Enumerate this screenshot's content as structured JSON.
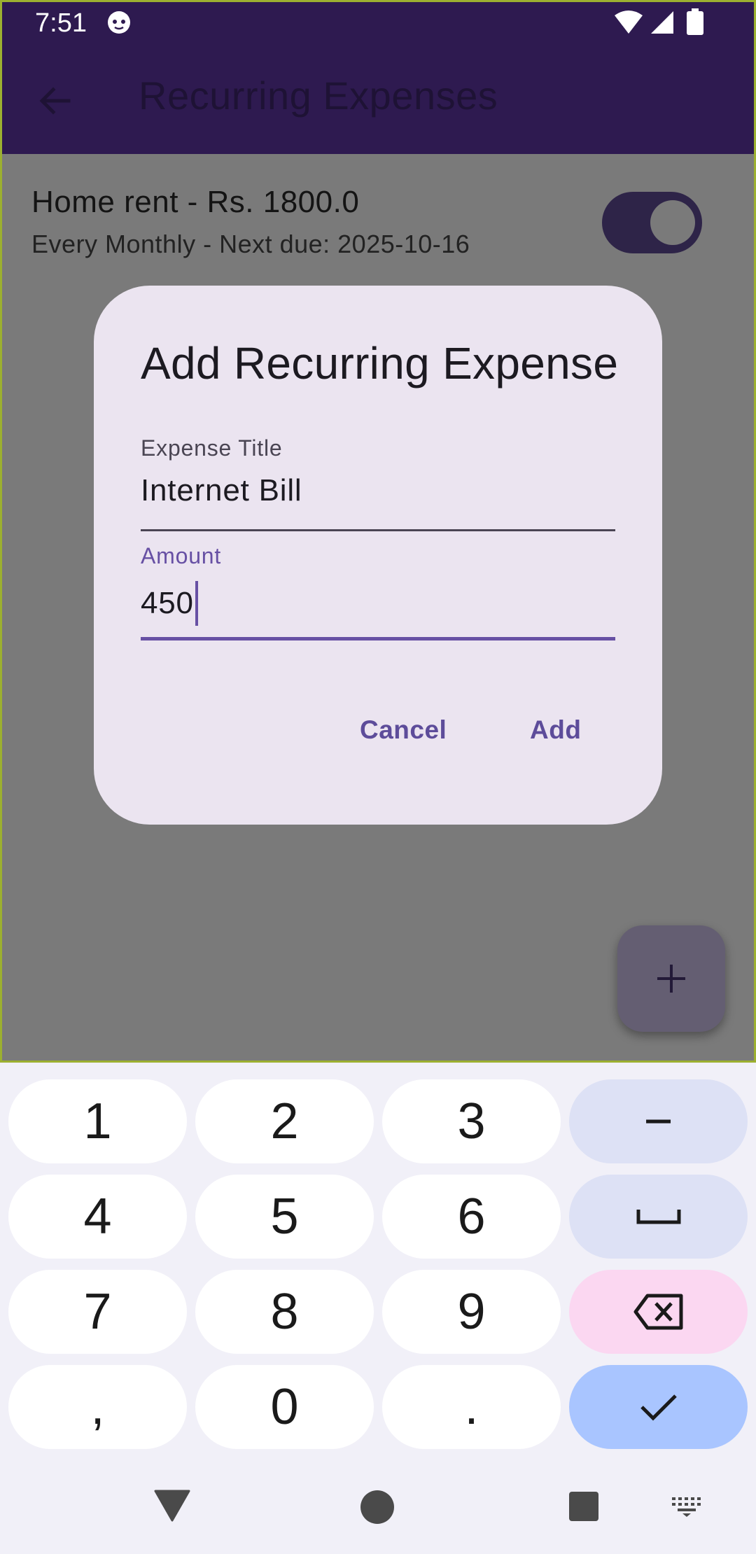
{
  "status_bar": {
    "time": "7:51"
  },
  "app_bar": {
    "title": "Recurring Expenses"
  },
  "list": {
    "items": [
      {
        "title": "Home rent - Rs. 1800.0",
        "subtitle": "Every Monthly - Next due: 2025-10-16",
        "toggle_on": true
      }
    ]
  },
  "dialog": {
    "title": "Add Recurring Expense",
    "fields": [
      {
        "label": "Expense Title",
        "value": "Internet Bill"
      },
      {
        "label": "Amount",
        "value": "450"
      }
    ],
    "actions": {
      "cancel": "Cancel",
      "add": "Add"
    }
  },
  "fab": {
    "icon": "plus-icon"
  },
  "keyboard": {
    "rows": [
      [
        "1",
        "2",
        "3",
        "−"
      ],
      [
        "4",
        "5",
        "6",
        "space"
      ],
      [
        "7",
        "8",
        "9",
        "backspace"
      ],
      [
        ",",
        "0",
        ".",
        "done"
      ]
    ]
  },
  "colors": {
    "app_bar": "#2e1a50",
    "accent": "#6750a4",
    "dialog_bg": "#ebe4f0",
    "scrim": "#7a7a7a"
  }
}
